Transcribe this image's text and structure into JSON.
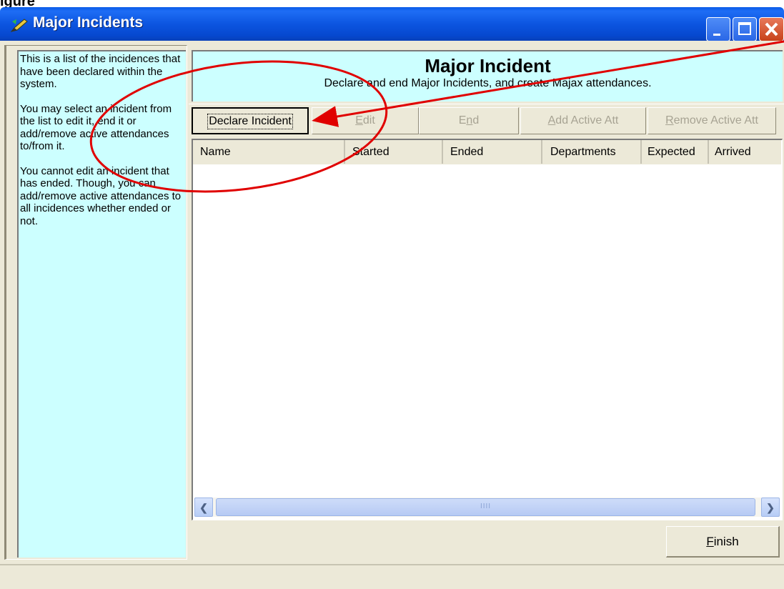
{
  "figure_caption": "igure",
  "window": {
    "title": "Major Incidents",
    "icon": "pencil-app-icon"
  },
  "help": {
    "paragraphs": [
      "This is a list of the incidences that have been declared within the system.",
      "You may select an incident from the list to edit it, end it or add/remove active attendances to/from it.",
      "You cannot edit an incident that has ended. Though, you can add/remove active attendances to all incidences whether ended or not."
    ]
  },
  "header": {
    "title": "Major Incident",
    "subtitle": "Declare and end Major Incidents, and create Majax attendances."
  },
  "toolbar": {
    "declare": "Declare Incident",
    "edit": "Edit",
    "end": "End",
    "add_active": "Add Active Att",
    "remove_active": "Remove Active Att"
  },
  "list": {
    "columns": [
      "Name",
      "Started",
      "Ended",
      "Departments",
      "Expected",
      "Arrived"
    ],
    "rows": [],
    "scroll_thumb": "IIII"
  },
  "footer": {
    "finish": "Finish"
  },
  "annotation": {
    "color": "#e00000"
  }
}
